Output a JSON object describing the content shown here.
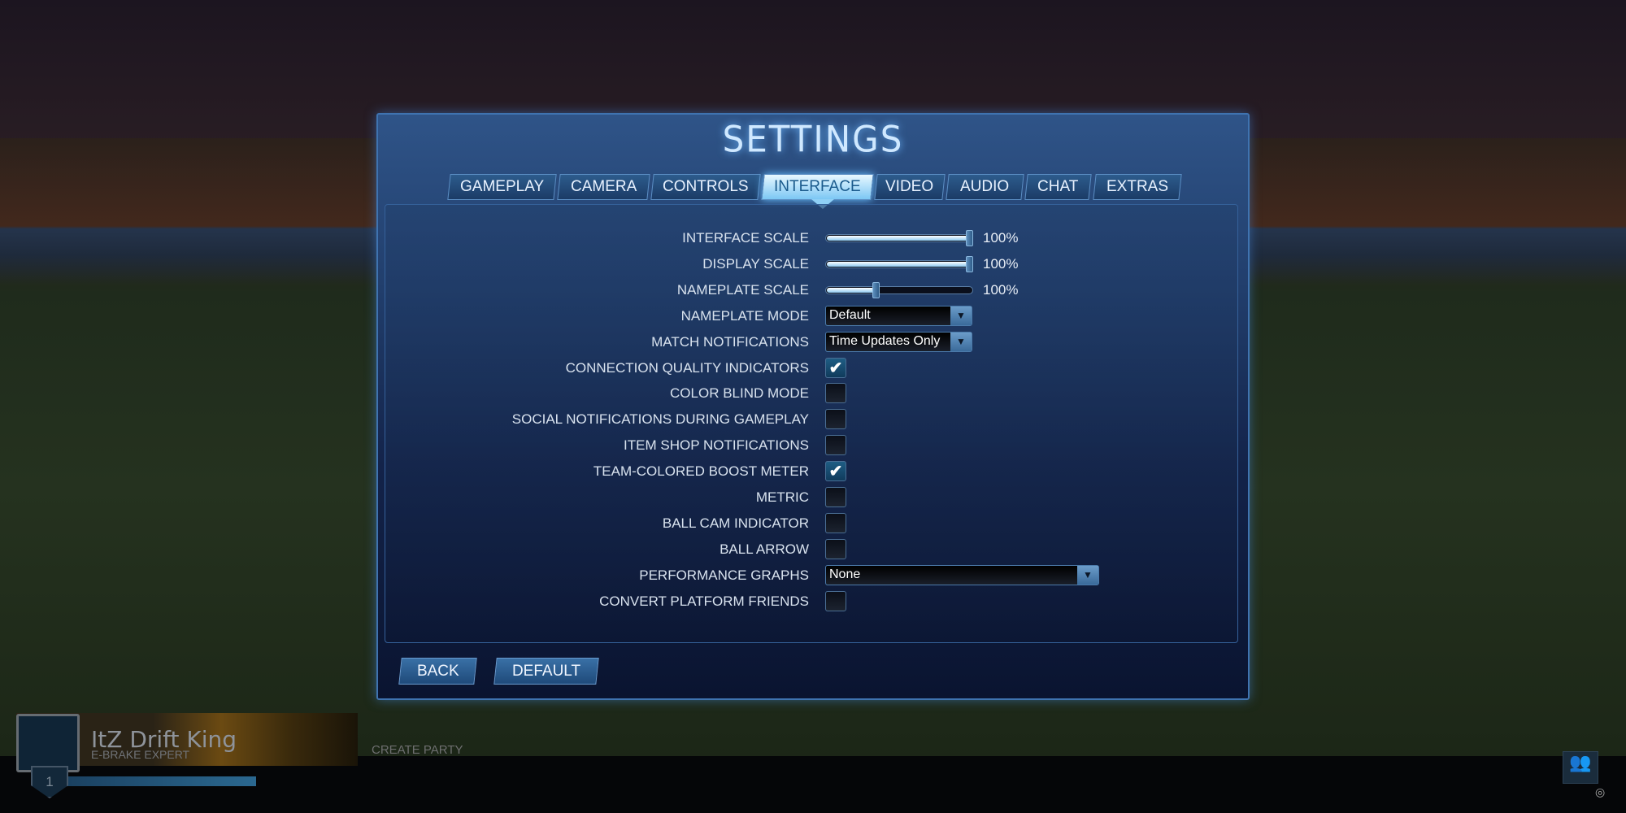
{
  "title": "SETTINGS",
  "tabs": [
    {
      "label": "GAMEPLAY"
    },
    {
      "label": "CAMERA"
    },
    {
      "label": "CONTROLS"
    },
    {
      "label": "INTERFACE",
      "active": true
    },
    {
      "label": "VIDEO"
    },
    {
      "label": "AUDIO"
    },
    {
      "label": "CHAT"
    },
    {
      "label": "EXTRAS"
    }
  ],
  "settings": {
    "interface_scale": {
      "label": "INTERFACE SCALE",
      "value": "100%",
      "level": 1.0
    },
    "display_scale": {
      "label": "DISPLAY SCALE",
      "value": "100%",
      "level": 1.0
    },
    "nameplate_scale": {
      "label": "NAMEPLATE SCALE",
      "value": "100%",
      "level": 0.33
    },
    "nameplate_mode": {
      "label": "NAMEPLATE MODE",
      "value": "Default"
    },
    "match_notifications": {
      "label": "MATCH NOTIFICATIONS",
      "value": "Time Updates Only"
    },
    "checks": [
      {
        "label": "CONNECTION QUALITY INDICATORS",
        "checked": true
      },
      {
        "label": "COLOR BLIND MODE",
        "checked": false
      },
      {
        "label": "SOCIAL NOTIFICATIONS DURING GAMEPLAY",
        "checked": false
      },
      {
        "label": "ITEM SHOP NOTIFICATIONS",
        "checked": false
      },
      {
        "label": "TEAM-COLORED BOOST METER",
        "checked": true
      },
      {
        "label": "METRIC",
        "checked": false
      },
      {
        "label": "BALL CAM INDICATOR",
        "checked": false
      },
      {
        "label": "BALL ARROW",
        "checked": false
      }
    ],
    "performance_graphs": {
      "label": "PERFORMANCE GRAPHS",
      "value": "None"
    },
    "convert_platform_friends": {
      "label": "CONVERT PLATFORM FRIENDS",
      "checked": false
    }
  },
  "buttons": {
    "back": "BACK",
    "default": "DEFAULT"
  },
  "player": {
    "name": "ItZ Drift King",
    "title": "E-BRAKE EXPERT",
    "level": "1",
    "create_party": "CREATE PARTY"
  },
  "checkmark": "✔",
  "colors": {
    "accent": "#6ac0ff",
    "panel": "#213e6c"
  }
}
